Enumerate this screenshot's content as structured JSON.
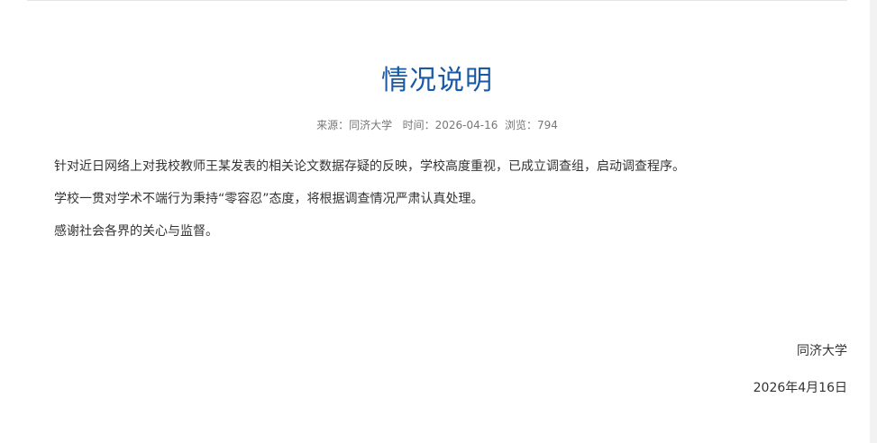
{
  "article": {
    "title": "情况说明",
    "meta": {
      "source_label": "来源：",
      "source": "同济大学",
      "time_label": "时间：",
      "time": "2026-04-16",
      "views_label": "浏览：",
      "views": "794"
    },
    "paragraphs": [
      "针对近日网络上对我校教师王某发表的相关论文数据存疑的反映，学校高度重视，已成立调查组，启动调查程序。",
      "学校一贯对学术不端行为秉持“零容忍”态度，将根据调查情况严肃认真处理。",
      "感谢社会各界的关心与监督。"
    ],
    "signature": {
      "organization": "同济大学",
      "date": "2026年4月16日"
    }
  },
  "colors": {
    "title": "#1a5aa5",
    "text": "#333333",
    "meta": "#777777"
  }
}
